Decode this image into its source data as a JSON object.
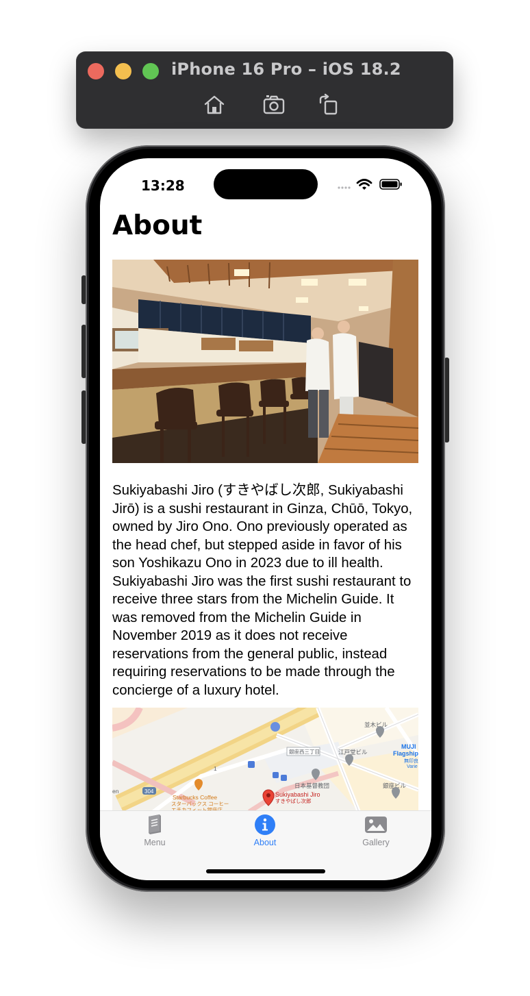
{
  "simulator": {
    "title": "iPhone 16 Pro – iOS 18.2",
    "toolbar_icons": [
      "home-icon",
      "screenshot-icon",
      "rotate-icon"
    ],
    "traffic_lights": {
      "close": "#ec6a5e",
      "minimize": "#f4bf4f",
      "zoom": "#61c554"
    }
  },
  "status_bar": {
    "time": "13:28",
    "icons": [
      "cellular-icon",
      "wifi-icon",
      "battery-icon"
    ]
  },
  "page": {
    "title": "About",
    "hero_image": "sushi-bar-interior-photo",
    "description": "Sukiyabashi Jiro (すきやばし次郎, Sukiyabashi Jirō) is a sushi restaurant in Ginza, Chūō, Tokyo, owned by Jiro Ono. Ono previously operated as the head chef, but stepped aside in favor of his son Yoshikazu Ono in 2023 due to ill health. Sukiyabashi Jiro was the first sushi restaurant to receive three stars from the Michelin Guide. It was removed from the Michelin Guide in November 2019 as it does not receive reservations from the general public, instead requiring reservations to be made through the concierge of a luxury hotel."
  },
  "map": {
    "pin_label": "Sukiyabashi Jiro",
    "pin_sublabel": "すきやばし次郎",
    "labels": {
      "namiki": "並木ビル",
      "ginza3": "銀座西三丁目",
      "edoya": "江戸堂ビル",
      "muji": "MUJI",
      "muji2": "Flagship",
      "muji3": "無印良",
      "muji4": "Varie",
      "kibun": "日本基督教団",
      "ginzabldg": "銀座ビル",
      "starbucks": "Starbucks Coffee",
      "starbucks2": "スターバックス コーヒー",
      "starbucks3": "エチカフィット銀座店",
      "route": "304",
      "lane": "1",
      "edge": "en"
    }
  },
  "tab_bar": {
    "tabs": [
      {
        "label": "Menu",
        "icon": "book-icon",
        "selected": false
      },
      {
        "label": "About",
        "icon": "info-icon",
        "selected": true
      },
      {
        "label": "Gallery",
        "icon": "photo-icon",
        "selected": false
      }
    ],
    "accent": "#2f7ff7",
    "inactive": "#8a8a8e"
  }
}
